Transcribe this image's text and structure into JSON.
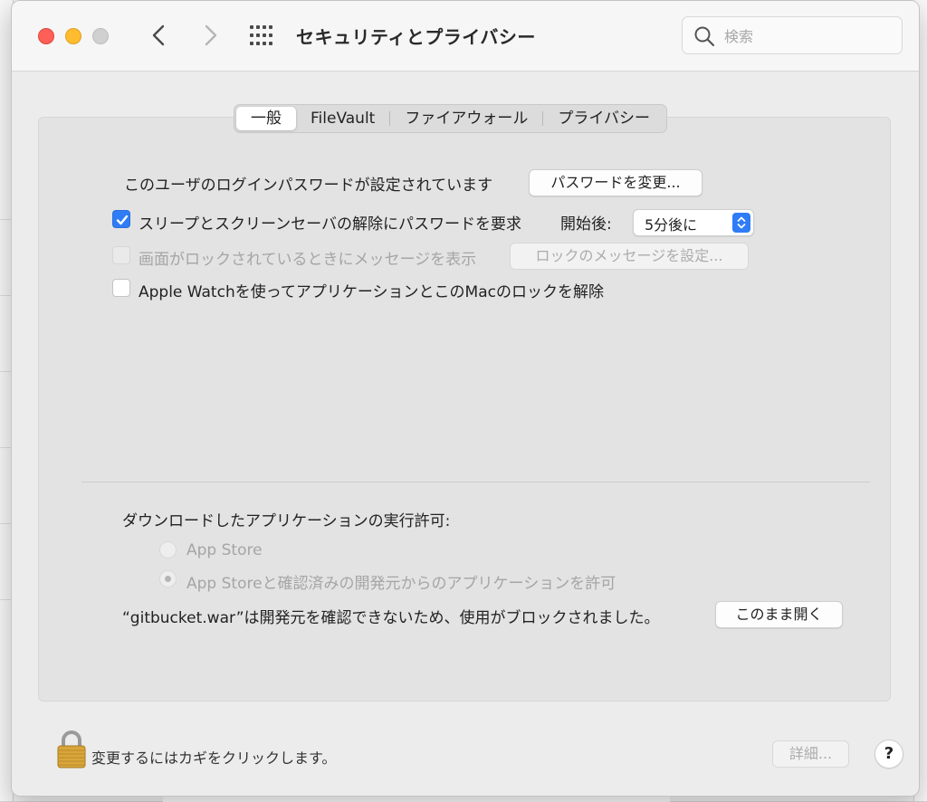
{
  "window": {
    "title": "セキュリティとプライバシー",
    "search_placeholder": "検索"
  },
  "tabs": [
    {
      "label": "一般",
      "selected": true
    },
    {
      "label": "FileVault",
      "selected": false
    },
    {
      "label": "ファイアウォール",
      "selected": false
    },
    {
      "label": "プライバシー",
      "selected": false
    }
  ],
  "general": {
    "password_status": "このユーザのログインパスワードが設定されています",
    "change_password_button": "パスワードを変更...",
    "require_password_label": "スリープとスクリーンセーバの解除にパスワードを要求",
    "require_password_checked": true,
    "start_after_label": "開始後:",
    "start_after_value": "5分後に",
    "lock_message_label": "画面がロックされているときにメッセージを表示",
    "lock_message_checked": false,
    "lock_message_button": "ロックのメッセージを設定...",
    "apple_watch_label": "Apple Watchを使ってアプリケーションとこのMacのロックを解除",
    "apple_watch_checked": false
  },
  "downloads": {
    "heading": "ダウンロードしたアプリケーションの実行許可:",
    "options": [
      {
        "label": "App Store",
        "selected": false
      },
      {
        "label": "App Storeと確認済みの開発元からのアプリケーションを許可",
        "selected": true
      }
    ],
    "blocked_message": "“gitbucket.war”は開発元を確認できないため、使用がブロックされました。",
    "open_anyway_button": "このまま開く"
  },
  "footer": {
    "lock_message": "変更するにはカギをクリックします。",
    "advanced_button": "詳細...",
    "help_button": "?"
  },
  "colors": {
    "accent": "#2f7cf6",
    "close": "#fe5f57",
    "minimize": "#febc2e"
  }
}
